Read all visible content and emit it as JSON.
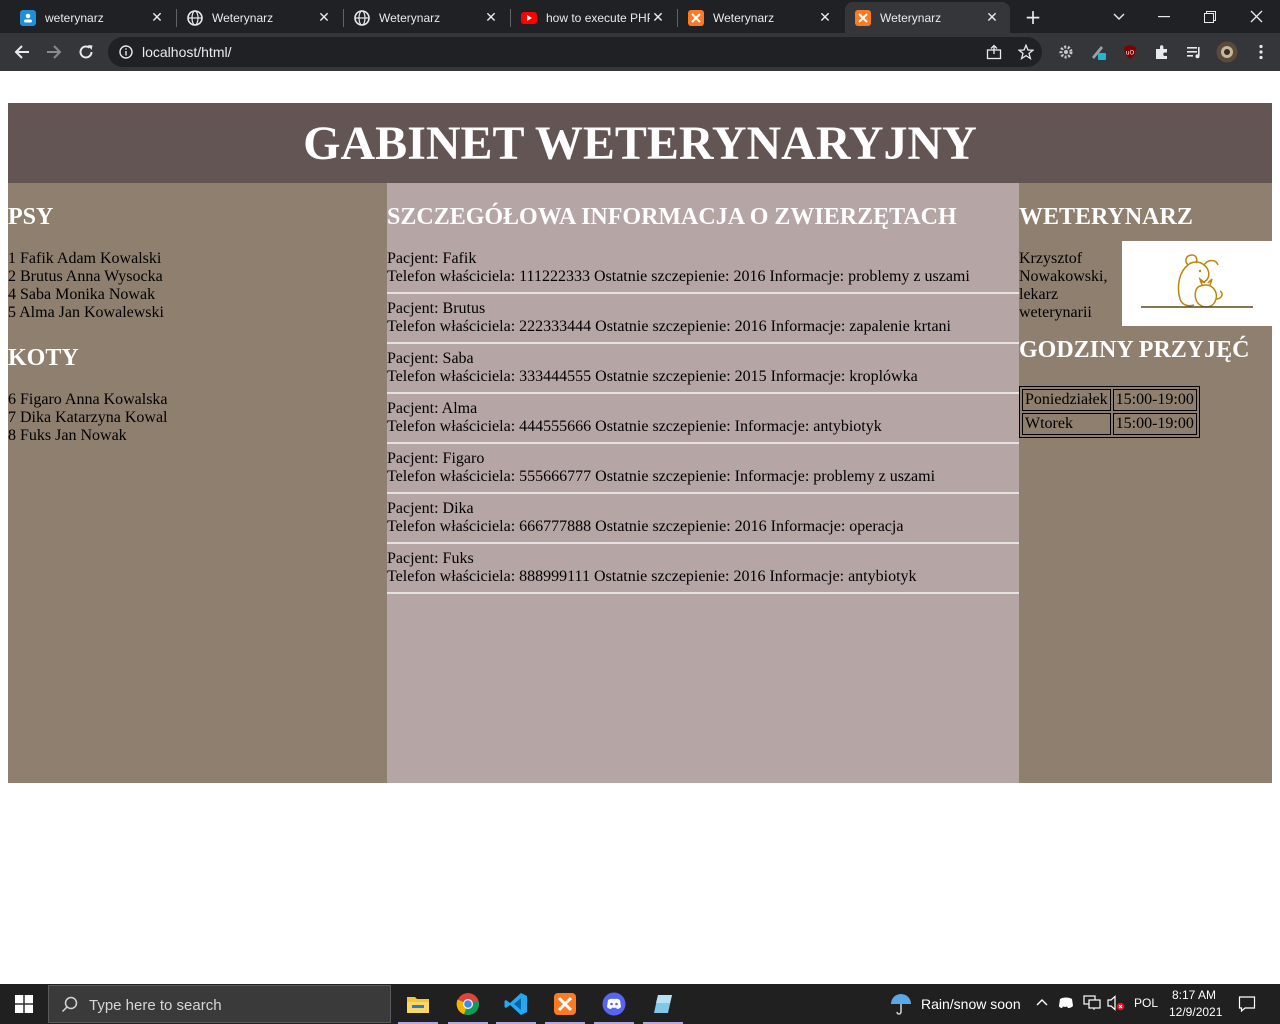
{
  "browser": {
    "tabs": [
      {
        "title": "weterynarz",
        "icon": "meet-icon",
        "icon_color": "#1e8fd8"
      },
      {
        "title": "Weterynarz",
        "icon": "globe-icon",
        "icon_color": "#e8eaed"
      },
      {
        "title": "Weterynarz",
        "icon": "globe-icon",
        "icon_color": "#e8eaed"
      },
      {
        "title": "how to execute PHP",
        "icon": "youtube-icon",
        "icon_color": "#ff0000"
      },
      {
        "title": "Weterynarz",
        "icon": "xampp-icon",
        "icon_color": "#fb7a24"
      },
      {
        "title": "Weterynarz",
        "icon": "xampp-icon",
        "icon_color": "#fb7a24",
        "active": true
      }
    ],
    "url": "localhost/html/"
  },
  "page": {
    "title": "GABINET WETERYNARYJNY",
    "dogs_heading": "PSY",
    "dogs": [
      "1 Fafik Adam Kowalski",
      "2 Brutus Anna Wysocka",
      "4 Saba Monika Nowak",
      "5 Alma Jan Kowalewski"
    ],
    "cats_heading": "KOTY",
    "cats": [
      "6 Figaro Anna Kowalska",
      "7 Dika Katarzyna Kowal",
      "8 Fuks Jan Nowak"
    ],
    "details_heading": "SZCZEGÓŁOWA INFORMACJA O ZWIERZĘTACH",
    "details": [
      {
        "patient": "Pacjent: Fafik",
        "info": "Telefon właściciela: 111222333 Ostatnie szczepienie: 2016 Informacje: problemy z uszami"
      },
      {
        "patient": "Pacjent: Brutus",
        "info": "Telefon właściciela: 222333444 Ostatnie szczepienie: 2016 Informacje: zapalenie krtani"
      },
      {
        "patient": "Pacjent: Saba",
        "info": "Telefon właściciela: 333444555 Ostatnie szczepienie: 2015 Informacje: kroplówka"
      },
      {
        "patient": "Pacjent: Alma",
        "info": "Telefon właściciela: 444555666 Ostatnie szczepienie: Informacje: antybiotyk"
      },
      {
        "patient": "Pacjent: Figaro",
        "info": "Telefon właściciela: 555666777 Ostatnie szczepienie: Informacje: problemy z uszami"
      },
      {
        "patient": "Pacjent: Dika",
        "info": "Telefon właściciela: 666777888 Ostatnie szczepienie: 2016 Informacje: operacja"
      },
      {
        "patient": "Pacjent: Fuks",
        "info": "Telefon właściciela: 888999111 Ostatnie szczepienie: 2016 Informacje: antybiotyk"
      }
    ],
    "vet_heading": "WETERYNARZ",
    "vet_name_lines": [
      "Krzysztof",
      "Nowakowski,",
      "lekarz",
      "weterynarii"
    ],
    "hours_heading": "GODZINY PRZYJĘĆ",
    "hours": [
      {
        "day": "Poniedziałek",
        "time": "15:00-19:00"
      },
      {
        "day": "Wtorek",
        "time": "15:00-19:00"
      }
    ]
  },
  "taskbar": {
    "search_placeholder": "Type here to search",
    "weather": "Rain/snow soon",
    "language": "POL",
    "time": "8:17 AM",
    "date": "12/9/2021"
  }
}
